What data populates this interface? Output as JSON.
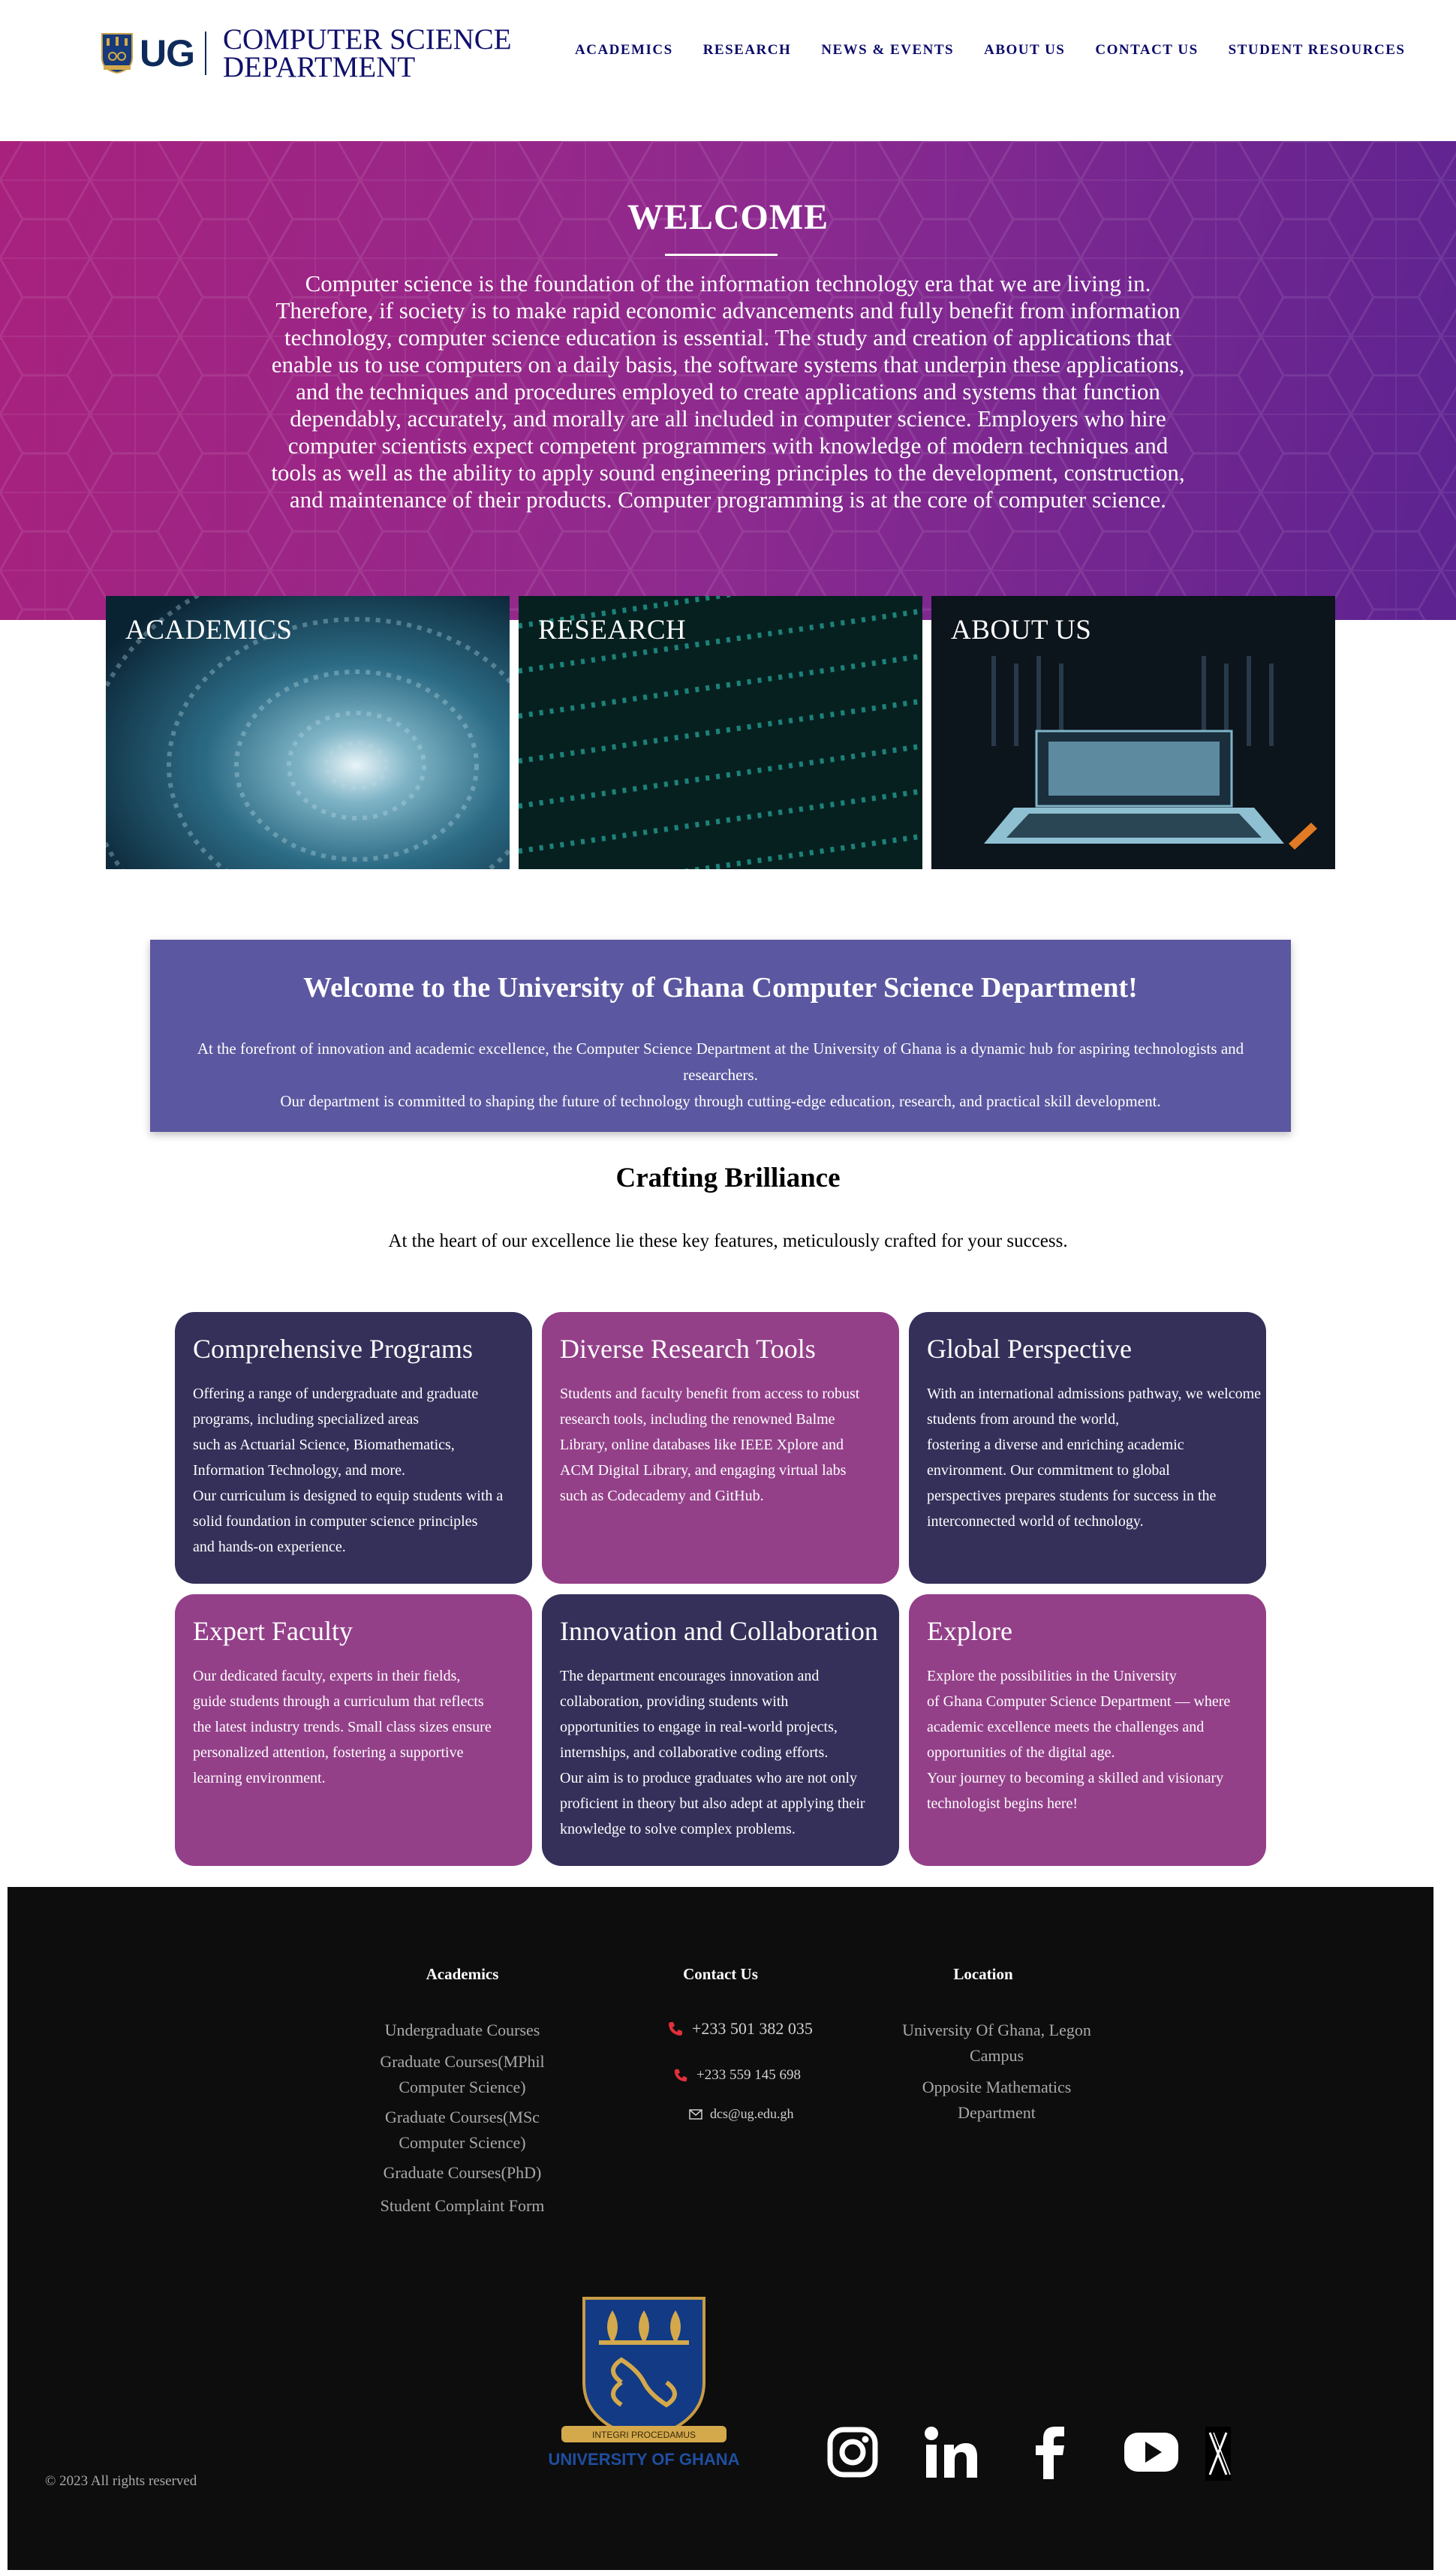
{
  "header": {
    "logo_text": "UG",
    "department_line1": "COMPUTER SCIENCE",
    "department_line2": "DEPARTMENT",
    "nav": [
      "ACADEMICS",
      "RESEARCH",
      "NEWS & EVENTS",
      "ABOUT US",
      "CONTACT US",
      "STUDENT RESOURCES"
    ]
  },
  "hero": {
    "title": "WELCOME",
    "lines": [
      "Computer science is the foundation of the information technology era that we are living in.",
      "Therefore, if society is to make rapid economic advancements and fully benefit from information",
      "technology, computer science education is essential. The study and creation of applications that",
      "enable us to use computers on a daily basis, the software systems that underpin these applications,",
      "and the techniques and procedures employed to create applications and systems that function",
      "dependably, accurately, and morally are all included in computer science. Employers who hire",
      "computer scientists expect competent programmers with knowledge of modern techniques and",
      "tools as well as the ability to apply sound engineering principles to the development, construction,",
      "and maintenance of their products. Computer programming is at the core of computer science."
    ]
  },
  "tiles": [
    "ACADEMICS",
    "RESEARCH",
    "ABOUT US"
  ],
  "welcome_box": {
    "title": "Welcome to the University of Ghana Computer Science Department!",
    "line1": "At the forefront of innovation and academic excellence, the Computer Science Department at the University of Ghana is a dynamic hub for aspiring technologists and",
    "line2": "researchers.",
    "line3": "Our department is committed to shaping the future of technology through cutting-edge education, research, and practical skill development."
  },
  "features": {
    "title": "Crafting Brilliance",
    "subtitle": "At the heart of our excellence lie these key features, meticulously crafted for your success.",
    "cards": [
      {
        "title": "Comprehensive Programs",
        "lines": [
          "Offering a range of undergraduate and graduate",
          "programs, including specialized areas",
          "such as Actuarial Science, Biomathematics,",
          "Information Technology, and more.",
          "Our curriculum is designed to equip students with a",
          "solid foundation in computer science principles",
          "and hands-on experience."
        ]
      },
      {
        "title": "Diverse Research Tools",
        "lines": [
          "Students and faculty benefit from access to robust",
          "research tools, including the renowned Balme",
          "Library, online databases like IEEE Xplore and",
          "ACM Digital Library, and engaging virtual labs",
          "such as Codecademy and GitHub."
        ]
      },
      {
        "title": "Global Perspective",
        "lines": [
          "With an international admissions pathway, we welcome",
          "students from around the world,",
          "fostering a diverse and enriching academic",
          "environment. Our commitment to global",
          "perspectives prepares students for success in the",
          "interconnected world of technology."
        ]
      },
      {
        "title": "Expert Faculty",
        "lines": [
          "Our dedicated faculty, experts in their fields,",
          "guide students through a curriculum that reflects",
          "the latest industry trends. Small class sizes ensure",
          "personalized attention, fostering a supportive",
          "learning environment."
        ]
      },
      {
        "title": "Innovation and Collaboration",
        "lines": [
          "The department encourages innovation and",
          "collaboration, providing students with",
          "opportunities to engage in real-world projects,",
          "internships, and collaborative coding efforts.",
          "Our aim is to produce graduates who are not only",
          "proficient in theory but also adept at applying their",
          "knowledge to solve complex problems."
        ]
      },
      {
        "title": "Explore",
        "lines": [
          "Explore the possibilities in the University",
          "of Ghana Computer Science Department — where",
          "academic excellence meets the challenges and",
          "opportunities of the digital age.",
          "Your journey to becoming a skilled and visionary",
          "technologist begins here!"
        ]
      }
    ]
  },
  "footer": {
    "academics": {
      "heading": "Academics",
      "links": [
        [
          "Undergraduate Courses"
        ],
        [
          "Graduate Courses(MPhil",
          "Computer Science)"
        ],
        [
          "Graduate Courses(MSc",
          "Computer Science)"
        ],
        [
          "Graduate Courses(PhD)"
        ],
        [
          "Student Complaint Form"
        ]
      ]
    },
    "contact": {
      "heading": "Contact Us",
      "phone1": "+233 501 382 035",
      "phone2": "+233 559 145 698",
      "email": "dcs@ug.edu.gh"
    },
    "location": {
      "heading": "Location",
      "line1": "University Of Ghana, Legon",
      "line2": "Campus",
      "line3": "Opposite Mathematics",
      "line4": "Department"
    },
    "logo_motto": "INTEGRI PROCEDAMUS",
    "logo_name": "UNIVERSITY OF GHANA",
    "copyright": "© 2023 All rights reserved",
    "social_icons": [
      "instagram-icon",
      "linkedin-icon",
      "facebook-icon",
      "youtube-icon",
      "x-icon"
    ]
  },
  "colors": {
    "nav_text": "#0a0a6a",
    "hero_start": "#a8217d",
    "hero_end": "#5c2391",
    "welcome_box": "#5b57a0",
    "card_dark": "#34305a",
    "card_pink": "#934089",
    "footer_bg": "#0d0d0d"
  }
}
